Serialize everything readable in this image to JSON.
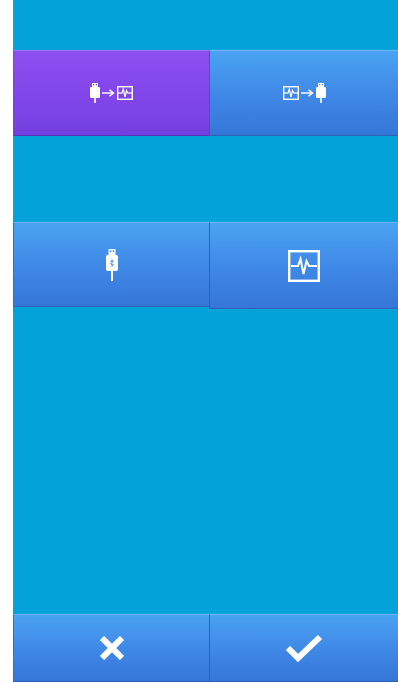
{
  "theme": {
    "background": "#03a3d9",
    "button_blue": "#3f87e6",
    "button_selected": "#7f45e8",
    "icon_color": "#ffffff"
  },
  "transfer_modes": [
    {
      "name": "usb-to-device",
      "icons": [
        "usb-drive-icon",
        "arrow-right-icon",
        "waveform-icon"
      ],
      "selected": true
    },
    {
      "name": "device-to-usb",
      "icons": [
        "waveform-icon",
        "arrow-right-icon",
        "usb-drive-icon"
      ],
      "selected": false
    }
  ],
  "storage_options": [
    {
      "name": "usb",
      "icon": "usb-drive-icon"
    },
    {
      "name": "device",
      "icon": "waveform-icon"
    }
  ],
  "actions": {
    "cancel_icon": "close-icon",
    "confirm_icon": "checkmark-icon"
  }
}
